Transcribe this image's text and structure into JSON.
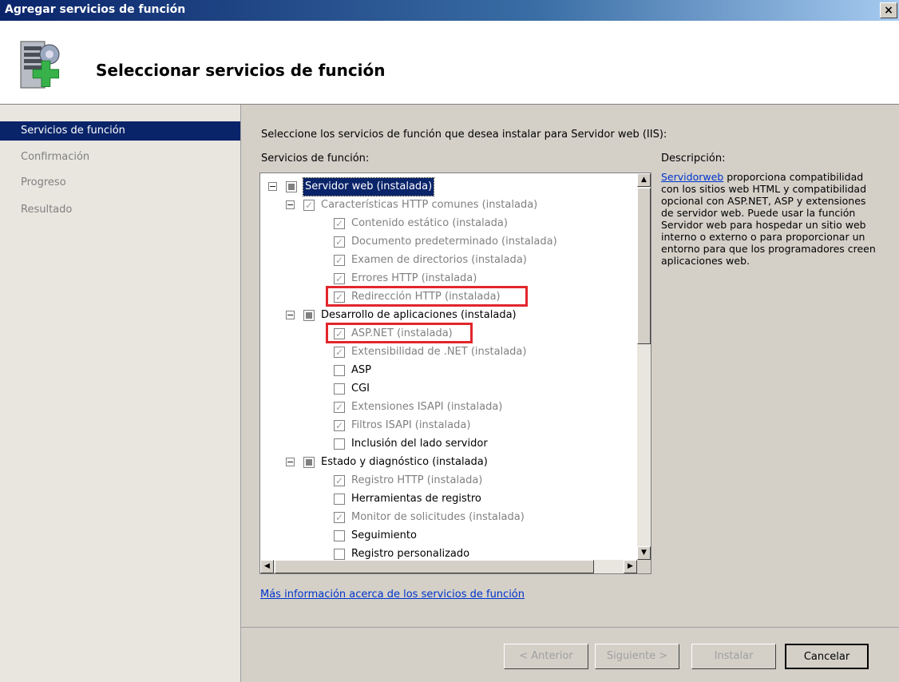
{
  "window": {
    "title": "Agregar servicios de función",
    "close": "×"
  },
  "header": {
    "heading": "Seleccionar servicios de función"
  },
  "nav": [
    {
      "label": "Servicios de función",
      "active": true
    },
    {
      "label": "Confirmación",
      "active": false
    },
    {
      "label": "Progreso",
      "active": false
    },
    {
      "label": "Resultado",
      "active": false
    }
  ],
  "main": {
    "instruction": "Seleccione los servicios de función que desea instalar para Servidor web (IIS):",
    "services_label": "Servicios de función:",
    "description_label": "Descripción:",
    "description_link": "Servidorweb",
    "description_text": " proporciona compatibilidad con los sitios web HTML y compatibilidad opcional con ASP.NET, ASP y extensiones de servidor web. Puede usar la función Servidor web para hospedar un sitio web interno o externo o para proporcionar un entorno para que los programadores creen aplicaciones web.",
    "more_info_link": "Más información acerca de los servicios de función"
  },
  "tree": [
    {
      "label": "Servidor web (instalada)",
      "level": 0,
      "expander": "−",
      "check": "partial",
      "gray": false,
      "selected": true
    },
    {
      "label": "Características HTTP comunes (instalada)",
      "level": 1,
      "expander": "−",
      "check": "checked",
      "gray": true
    },
    {
      "label": "Contenido estático (instalada)",
      "level": 2,
      "check": "checked",
      "gray": true
    },
    {
      "label": "Documento predeterminado (instalada)",
      "level": 2,
      "check": "checked",
      "gray": true
    },
    {
      "label": "Examen de directorios (instalada)",
      "level": 2,
      "check": "checked",
      "gray": true
    },
    {
      "label": "Errores HTTP (instalada)",
      "level": 2,
      "check": "checked",
      "gray": true
    },
    {
      "label": "Redirección HTTP (instalada)",
      "level": 2,
      "check": "checked",
      "gray": true,
      "highlight": true
    },
    {
      "label": "Desarrollo de aplicaciones (instalada)",
      "level": 1,
      "expander": "−",
      "check": "partial",
      "gray": false
    },
    {
      "label": "ASP.NET (instalada)",
      "level": 2,
      "check": "checked",
      "gray": true,
      "highlight": true
    },
    {
      "label": "Extensibilidad de .NET (instalada)",
      "level": 2,
      "check": "checked",
      "gray": true
    },
    {
      "label": "ASP",
      "level": 2,
      "check": "empty",
      "gray": false
    },
    {
      "label": "CGI",
      "level": 2,
      "check": "empty",
      "gray": false
    },
    {
      "label": "Extensiones ISAPI (instalada)",
      "level": 2,
      "check": "checked",
      "gray": true
    },
    {
      "label": "Filtros ISAPI (instalada)",
      "level": 2,
      "check": "checked",
      "gray": true
    },
    {
      "label": "Inclusión del lado servidor",
      "level": 2,
      "check": "empty",
      "gray": false
    },
    {
      "label": "Estado y diagnóstico (instalada)",
      "level": 1,
      "expander": "−",
      "check": "partial",
      "gray": false
    },
    {
      "label": "Registro HTTP (instalada)",
      "level": 2,
      "check": "checked",
      "gray": true
    },
    {
      "label": "Herramientas de registro",
      "level": 2,
      "check": "empty",
      "gray": false
    },
    {
      "label": "Monitor de solicitudes (instalada)",
      "level": 2,
      "check": "checked",
      "gray": true
    },
    {
      "label": "Seguimiento",
      "level": 2,
      "check": "empty",
      "gray": false
    },
    {
      "label": "Registro personalizado",
      "level": 2,
      "check": "empty",
      "gray": false
    }
  ],
  "buttons": {
    "back": "< Anterior",
    "next": "Siguiente >",
    "install": "Instalar",
    "cancel": "Cancelar"
  },
  "colors": {
    "selection": "#0a246a",
    "highlight_box": "#e2262b",
    "link": "#0033cc"
  }
}
